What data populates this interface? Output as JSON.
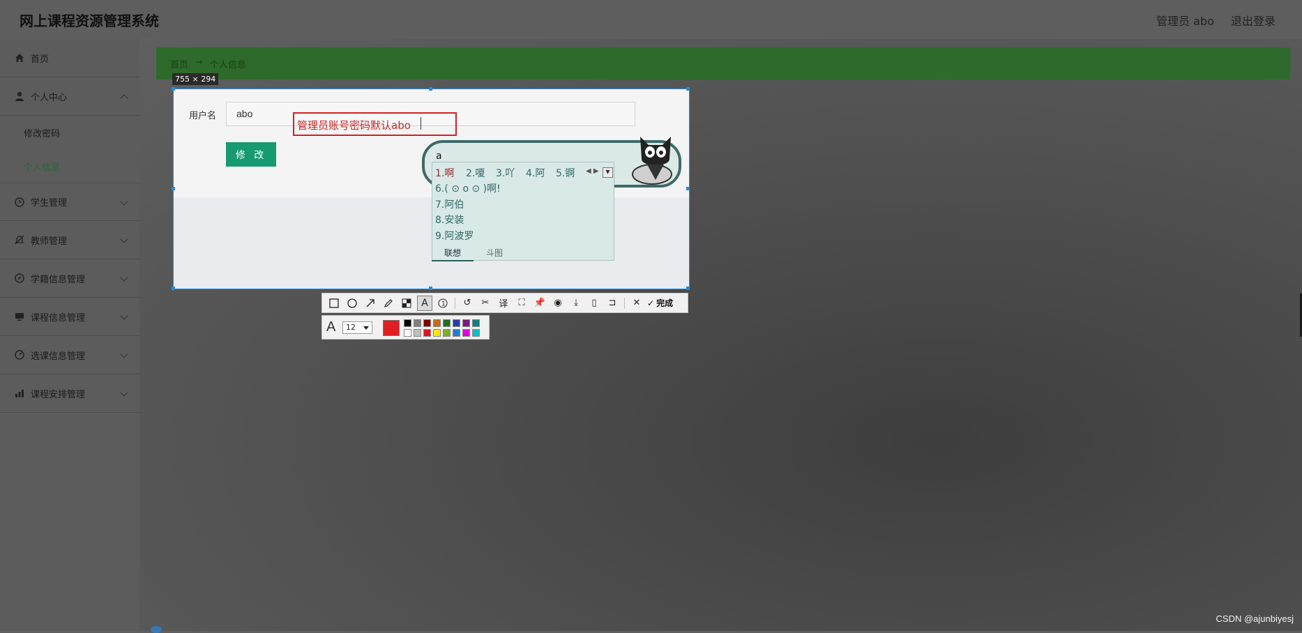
{
  "app": {
    "title": "网上课程资源管理系统"
  },
  "header": {
    "admin_label": "管理员 abo",
    "logout_label": "退出登录"
  },
  "sidebar": {
    "items": [
      {
        "label": "首页",
        "icon": "home-icon"
      },
      {
        "label": "个人中心",
        "icon": "user-icon",
        "expanded": true,
        "children": [
          {
            "label": "修改密码"
          },
          {
            "label": "个人信息",
            "active": true
          }
        ]
      },
      {
        "label": "学生管理",
        "icon": "clock-icon"
      },
      {
        "label": "教师管理",
        "icon": "no-bell-icon"
      },
      {
        "label": "学籍信息管理",
        "icon": "compass-icon"
      },
      {
        "label": "课程信息管理",
        "icon": "monitor-icon"
      },
      {
        "label": "选课信息管理",
        "icon": "gauge-icon"
      },
      {
        "label": "课程安排管理",
        "icon": "chart-icon"
      }
    ]
  },
  "breadcrumb": {
    "home": "首页",
    "separator": "→",
    "current": "个人信息"
  },
  "capture": {
    "size_label": "755 × 294"
  },
  "form": {
    "username_label": "用户名",
    "username_value": "abo",
    "modify_label": "修 改"
  },
  "annotation": {
    "text": "管理员账号密码默认abo"
  },
  "ime": {
    "input": "a",
    "candidates": [
      "1.啊",
      "2.嗄",
      "3.吖",
      "4.阿",
      "5.锕",
      "6.( ⊙ o ⊙ )啊!",
      "7.阿伯",
      "8.安装",
      "9.阿波罗"
    ],
    "tabs": [
      "联想",
      "斗图"
    ]
  },
  "screenshot_tool": {
    "done_label": "完成",
    "font_size": "12",
    "current_color": "#df1f24",
    "palette": [
      "#000000",
      "#808080",
      "#800000",
      "#c86a14",
      "#1e6e1e",
      "#2a3ab0",
      "#7a1a7a",
      "#108080",
      "#ffffff",
      "#c0c0c0",
      "#e0141e",
      "#ffe600",
      "#80b01e",
      "#1e7ed2",
      "#e000e0",
      "#10c0c0"
    ]
  },
  "watermark": "CSDN @ajunbiyesj"
}
